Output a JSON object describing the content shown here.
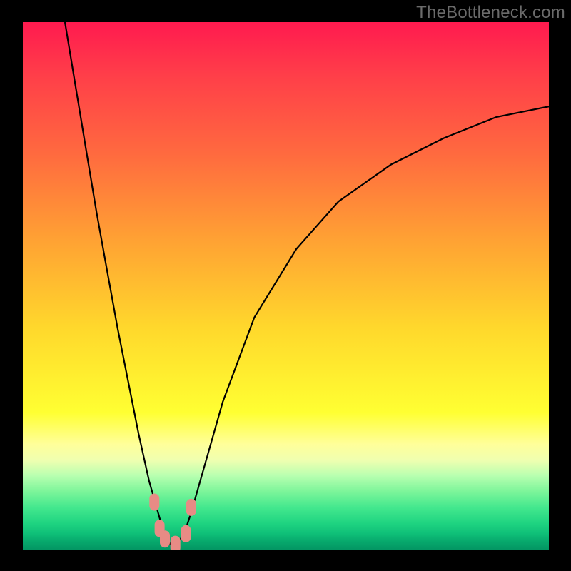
{
  "watermark": "TheBottleneck.com",
  "chart_data": {
    "type": "line",
    "title": "",
    "xlabel": "",
    "ylabel": "",
    "xlim": [
      0,
      100
    ],
    "ylim": [
      0,
      100
    ],
    "grid": false,
    "legend": false,
    "series": [
      {
        "name": "bottleneck-curve",
        "x": [
          8,
          10,
          12,
          14,
          16,
          18,
          20,
          22,
          24,
          26,
          27,
          28,
          29,
          30,
          31,
          32,
          34,
          38,
          44,
          52,
          60,
          70,
          80,
          90,
          100
        ],
        "y": [
          100,
          88,
          76,
          64,
          53,
          42,
          32,
          22,
          13,
          6,
          3,
          1,
          1,
          2,
          4,
          7,
          14,
          28,
          44,
          57,
          66,
          73,
          78,
          82,
          84
        ]
      }
    ],
    "markers": [
      {
        "name": "trough-marker-left",
        "x": 25,
        "y": 9
      },
      {
        "name": "trough-marker-mid1",
        "x": 26,
        "y": 4
      },
      {
        "name": "trough-marker-mid2",
        "x": 27,
        "y": 2
      },
      {
        "name": "trough-marker-mid3",
        "x": 29,
        "y": 1
      },
      {
        "name": "trough-marker-mid4",
        "x": 31,
        "y": 3
      },
      {
        "name": "trough-marker-right",
        "x": 32,
        "y": 8
      }
    ],
    "note": "Values estimated from pixel gradient — x and y normalized 0–100 within plot area; y measures height above green baseline."
  },
  "colors": {
    "curve": "#000000",
    "marker": "#e88b85",
    "frame": "#000000",
    "watermark": "#6b6b6b"
  }
}
